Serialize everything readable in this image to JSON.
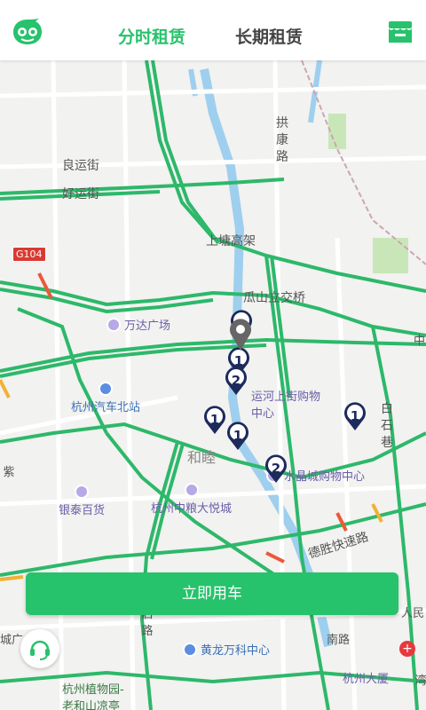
{
  "header": {
    "tabs": [
      {
        "label": "分时租赁",
        "active": true
      },
      {
        "label": "长期租赁",
        "active": false
      }
    ]
  },
  "colors": {
    "accent": "#27c26c",
    "marker": "#1d2a5c"
  },
  "map": {
    "road_shield": "G104",
    "labels": {
      "gongkang": "拱康路",
      "liangyun": "良运街",
      "haoyun": "好运街",
      "shangtang": "上塘高架",
      "guashan": "瓜山立交桥",
      "hemu": "和睦",
      "baishixiang": "白石巷",
      "deshengkuaisu": "德胜快速路",
      "nan_road": "南路",
      "renmin": "人民",
      "cheng": "城广",
      "zi": "紫",
      "qiying": "启路",
      "shi": "石",
      "hao": "湾",
      "zhong": "中"
    },
    "pois": [
      {
        "name": "万达广场",
        "icon": "shopping-icon"
      },
      {
        "name": "杭州汽车北站",
        "icon": "bus-station-icon"
      },
      {
        "name": "运河上街购物中心",
        "icon": "shopping-icon"
      },
      {
        "name": "水晶城购物中心",
        "icon": "shopping-icon"
      },
      {
        "name": "银泰百货",
        "icon": "shopping-icon"
      },
      {
        "name": "杭州中粮大悦城",
        "icon": "shopping-icon"
      },
      {
        "name": "黄龙万科中心",
        "icon": "building-icon"
      },
      {
        "name": "杭州植物园-老和山凉亭",
        "icon": "park-icon"
      },
      {
        "name": "杭州大厦",
        "icon": "shopping-icon"
      }
    ],
    "markers": [
      {
        "count": ""
      },
      {
        "count": "1"
      },
      {
        "count": "2"
      },
      {
        "count": "1"
      },
      {
        "count": "1"
      },
      {
        "count": "1"
      },
      {
        "count": "2"
      }
    ]
  },
  "actions": {
    "rent_now": "立即用车"
  }
}
